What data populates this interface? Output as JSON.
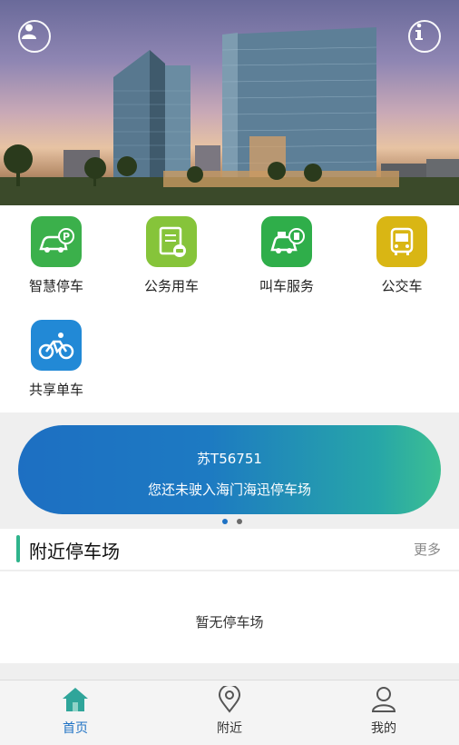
{
  "hero": {
    "profile_icon": "user-icon",
    "info_icon": "info-icon"
  },
  "services": [
    {
      "label": "智慧停车",
      "icon": "car-parking-icon",
      "color": "#3bb04b"
    },
    {
      "label": "公务用车",
      "icon": "document-car-icon",
      "color": "#86c43a"
    },
    {
      "label": "叫车服务",
      "icon": "taxi-icon",
      "color": "#2fae4a"
    },
    {
      "label": "公交车",
      "icon": "bus-icon",
      "color": "#d9b614"
    },
    {
      "label": "共享单车",
      "icon": "bicycle-icon",
      "color": "#2289d6"
    }
  ],
  "vehicle_card": {
    "plate": "苏T56751",
    "message": "您还未驶入海门海迅停车场",
    "page_count": 2,
    "active_page": 1
  },
  "nearby": {
    "title": "附近停车场",
    "more": "更多",
    "empty_text": "暂无停车场"
  },
  "bottom_nav": [
    {
      "label": "首页",
      "icon": "home-icon",
      "active": true
    },
    {
      "label": "附近",
      "icon": "location-pin-icon",
      "active": false
    },
    {
      "label": "我的",
      "icon": "user-icon",
      "active": false
    }
  ],
  "colors": {
    "accent": "#1f72c4",
    "section_bar": "#2fb48c"
  }
}
